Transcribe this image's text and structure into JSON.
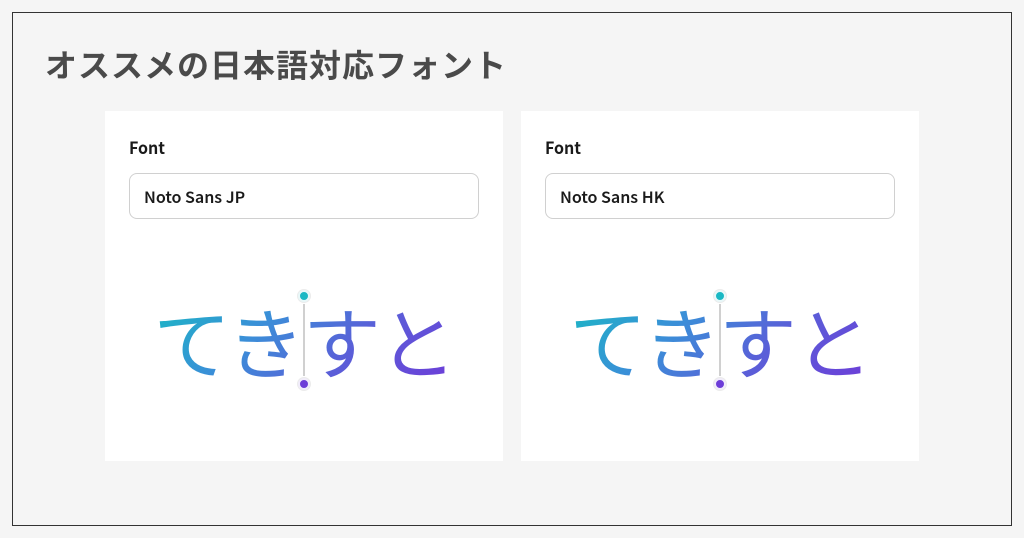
{
  "title": "オススメの日本語対応フォント",
  "cards": [
    {
      "label": "Font",
      "fontName": "Noto Sans JP",
      "previewText": "てきすと"
    },
    {
      "label": "Font",
      "fontName": "Noto Sans HK",
      "previewText": "てきすと"
    }
  ],
  "colors": {
    "gradientStart": "#1ab8c4",
    "gradientEnd": "#6d3dd8"
  }
}
